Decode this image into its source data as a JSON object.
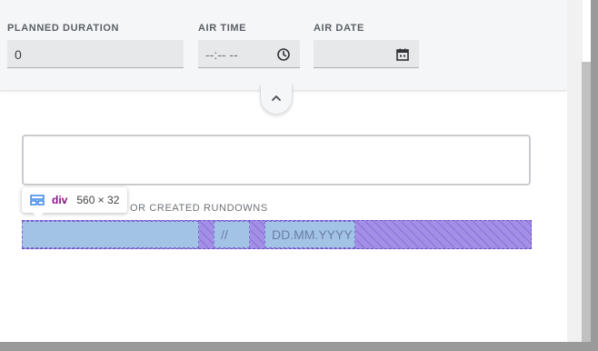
{
  "form": {
    "planned_duration": {
      "label": "PLANNED DURATION",
      "value": "0"
    },
    "air_time": {
      "label": "AIR TIME",
      "value": "--:-- --"
    },
    "air_date": {
      "label": "AIR DATE",
      "value": ""
    }
  },
  "section": {
    "label": "OR CREATED RUNDOWNS"
  },
  "inspector_tooltip": {
    "tag": "div",
    "dimensions": "560 × 32"
  },
  "highlight_row": {
    "separator": "//",
    "date_placeholder": "DD.MM.YYYY"
  },
  "icons": {
    "collapse": "chevron-up-icon",
    "time": "clock-icon",
    "date": "calendar-icon",
    "element_type": "flex-layout-icon"
  },
  "colors": {
    "inspector_tag": "#881280",
    "highlight_padding": "#a38fe6",
    "highlight_content": "#a3c3e6"
  }
}
